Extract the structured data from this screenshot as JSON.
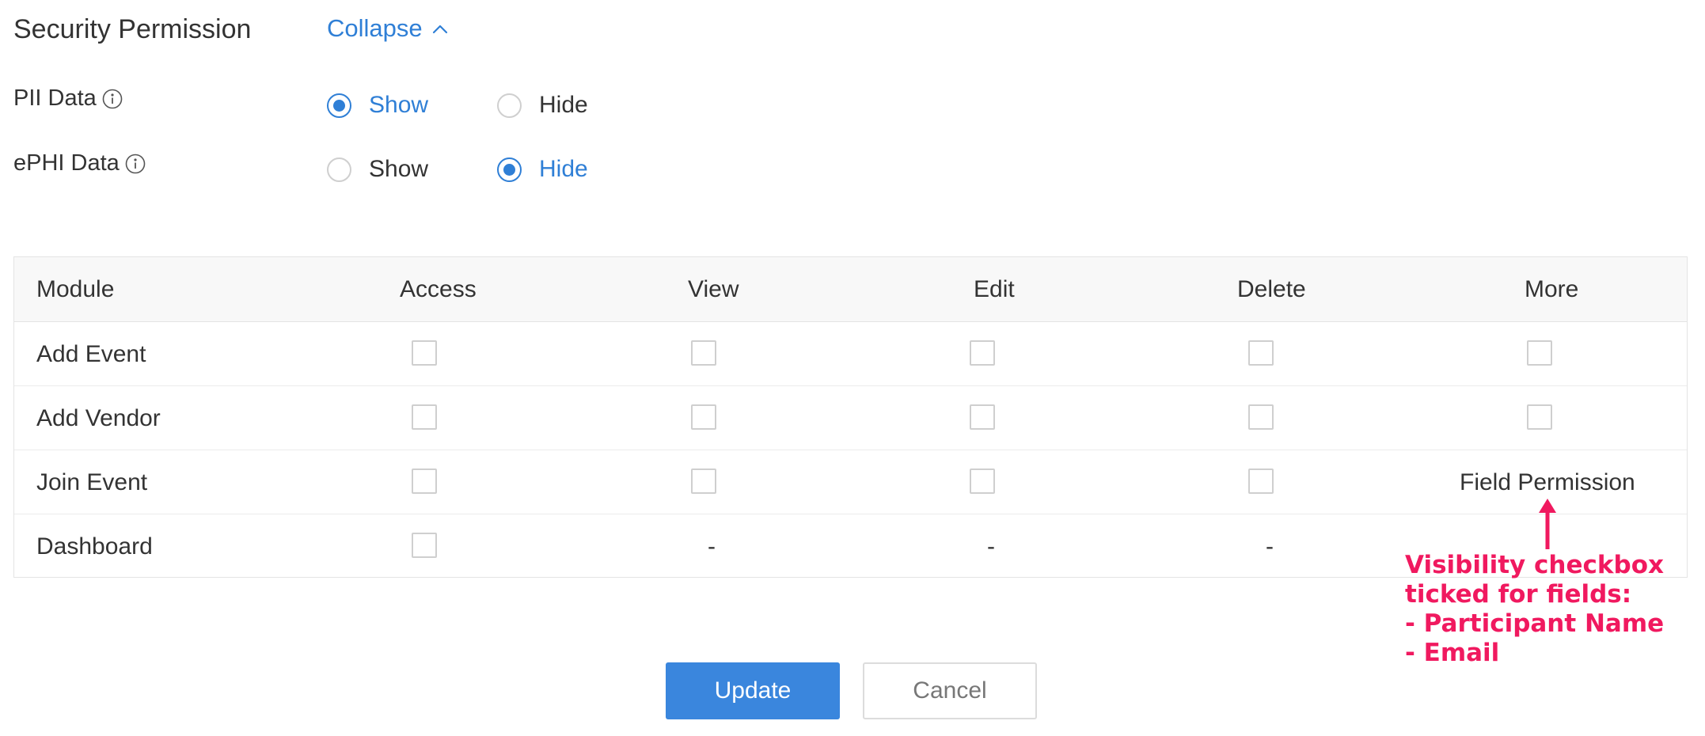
{
  "security": {
    "title": "Security Permission",
    "collapse_label": "Collapse",
    "rows": [
      {
        "label": "PII Data",
        "options": [
          "Show",
          "Hide"
        ],
        "selected": "Show"
      },
      {
        "label": "ePHI Data",
        "options": [
          "Show",
          "Hide"
        ],
        "selected": "Hide"
      }
    ]
  },
  "table": {
    "headers": [
      "Module",
      "Access",
      "View",
      "Edit",
      "Delete",
      "More"
    ],
    "rows": [
      {
        "module": "Add Event",
        "access": "checkbox",
        "view": "checkbox",
        "edit": "checkbox",
        "delete": "checkbox",
        "more": "checkbox"
      },
      {
        "module": "Add Vendor",
        "access": "checkbox",
        "view": "checkbox",
        "edit": "checkbox",
        "delete": "checkbox",
        "more": "checkbox"
      },
      {
        "module": "Join Event",
        "access": "checkbox",
        "view": "checkbox",
        "edit": "checkbox",
        "delete": "checkbox",
        "more": "Field Permission"
      },
      {
        "module": "Dashboard",
        "access": "checkbox",
        "view": "-",
        "edit": "-",
        "delete": "-",
        "more": ""
      }
    ]
  },
  "buttons": {
    "update": "Update",
    "cancel": "Cancel"
  },
  "annotation": {
    "lines": [
      "Visibility checkbox",
      "ticked for fields:",
      "- Participant Name",
      "- Email"
    ],
    "color": "#f0195f"
  },
  "colors": {
    "accent": "#2f7fd6",
    "primary_button": "#3a86dd"
  },
  "icons": [
    "chevron-up-icon",
    "info-icon",
    "arrow-up-icon"
  ]
}
